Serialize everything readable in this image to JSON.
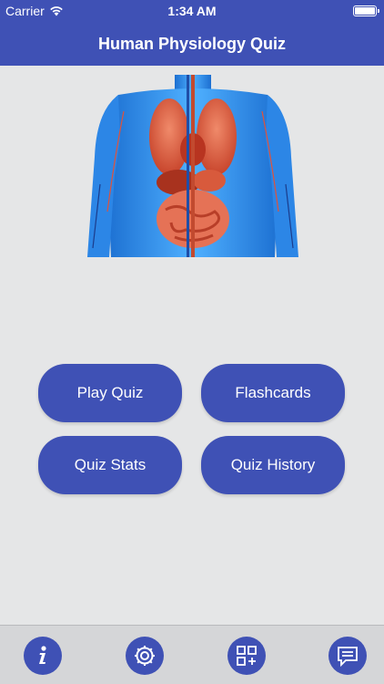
{
  "status_bar": {
    "carrier": "Carrier",
    "time": "1:34 AM"
  },
  "header": {
    "title": "Human Physiology Quiz"
  },
  "menu": {
    "play_quiz": "Play Quiz",
    "flashcards": "Flashcards",
    "quiz_stats": "Quiz Stats",
    "quiz_history": "Quiz History"
  },
  "tab_bar": {
    "items": [
      {
        "icon": "info-icon"
      },
      {
        "icon": "gear-icon"
      },
      {
        "icon": "apps-grid-icon"
      },
      {
        "icon": "chat-icon"
      }
    ]
  },
  "colors": {
    "primary": "#3f51b5",
    "background": "#e5e6e7",
    "tab_bar": "#d5d6d8"
  }
}
